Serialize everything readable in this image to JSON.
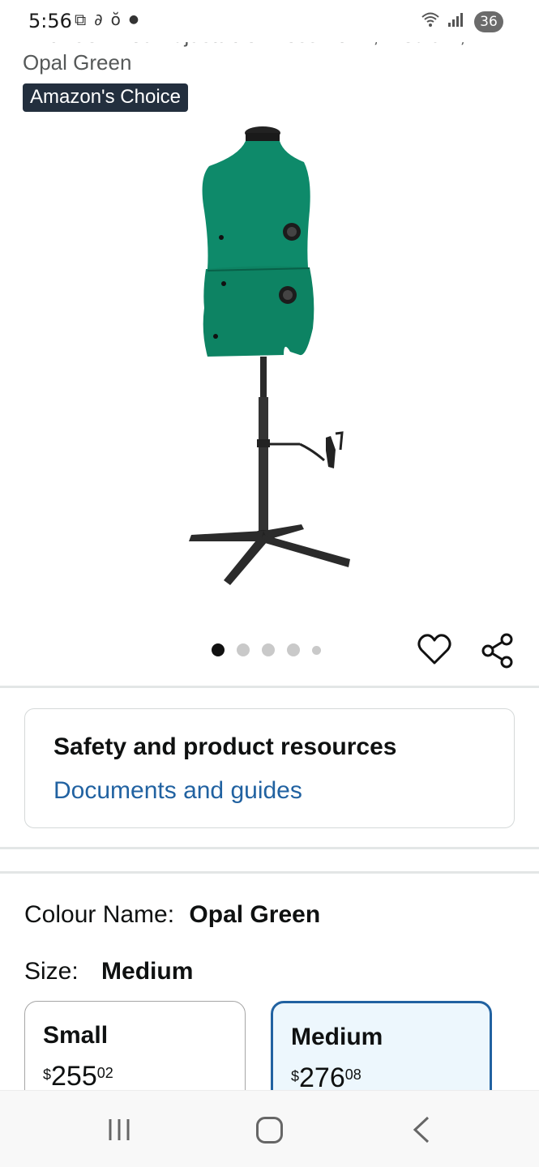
{
  "status_bar": {
    "time": "5:56",
    "battery": "36",
    "left_icons": [
      "screenshot-icon",
      "link-icon",
      "app-notification-icon",
      "dot-icon"
    ],
    "right_icons": [
      "wifi-icon",
      "signal-icon"
    ]
  },
  "product": {
    "title_line1": "Dritz Sew You Adjustable Dress Form, Medium,",
    "title_line2": "Opal Green",
    "badge": "Amazon's Choice"
  },
  "gallery": {
    "image_count": 5,
    "active_index": 0,
    "product_color": "#0e8a6a"
  },
  "safety": {
    "title": "Safety and product resources",
    "link": "Documents and guides"
  },
  "options": {
    "colour_label": "Colour Name:",
    "colour_value": "Opal Green",
    "size_label": "Size:",
    "size_value": "Medium"
  },
  "sizes": [
    {
      "name": "Small",
      "currency": "$",
      "whole": "255",
      "fraction": "02",
      "selected": false
    },
    {
      "name": "Medium",
      "currency": "$",
      "whole": "276",
      "fraction": "08",
      "selected": true
    }
  ],
  "colors": {
    "link": "#2162a1",
    "badge_bg": "#232f3e",
    "selected_border": "#2162a1",
    "selected_bg": "#edf7fd"
  }
}
